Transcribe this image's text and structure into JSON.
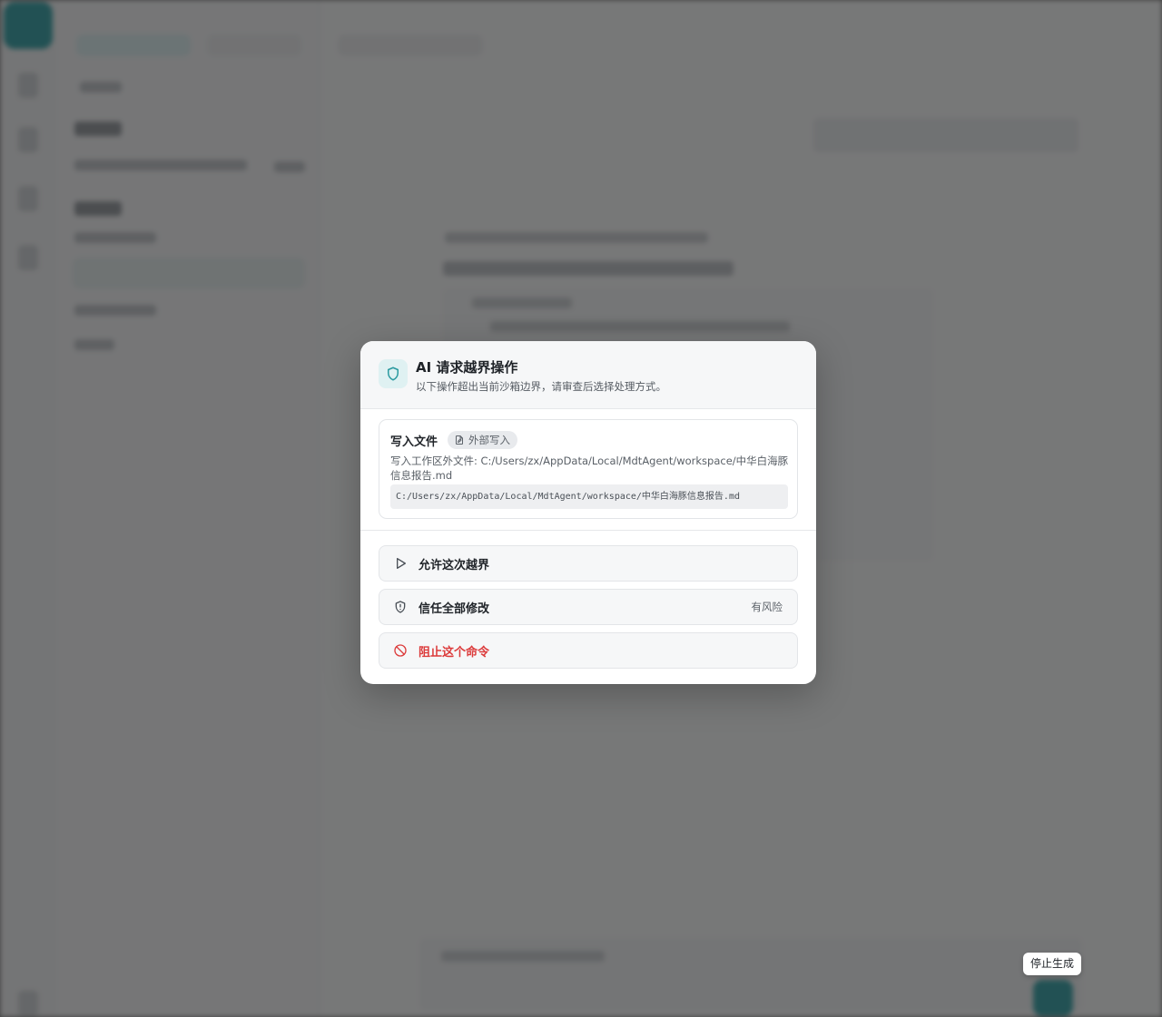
{
  "dialog": {
    "title": "AI 请求越界操作",
    "subtitle": "以下操作超出当前沙箱边界，请审查后选择处理方式。",
    "icon": "shield-icon",
    "accent_color": "#2a9aa0"
  },
  "request": {
    "type_label": "写入文件",
    "tag_label": "外部写入",
    "tag_icon": "file-edit-icon",
    "description": "写入工作区外文件: C:/Users/zx/AppData/Local/MdtAgent/workspace/中华白海豚信息报告.md",
    "path": "C:/Users/zx/AppData/Local/MdtAgent/workspace/中华白海豚信息报告.md"
  },
  "options": [
    {
      "label": "允许这次越界",
      "icon": "play-icon",
      "risk": ""
    },
    {
      "label": "信任全部修改",
      "icon": "shield-alert-icon",
      "risk": "有风险"
    },
    {
      "label": "阻止这个命令",
      "icon": "block-icon",
      "risk": "",
      "color": "#dc3b3b"
    }
  ],
  "tooltip": {
    "stop_label": "停止生成"
  }
}
